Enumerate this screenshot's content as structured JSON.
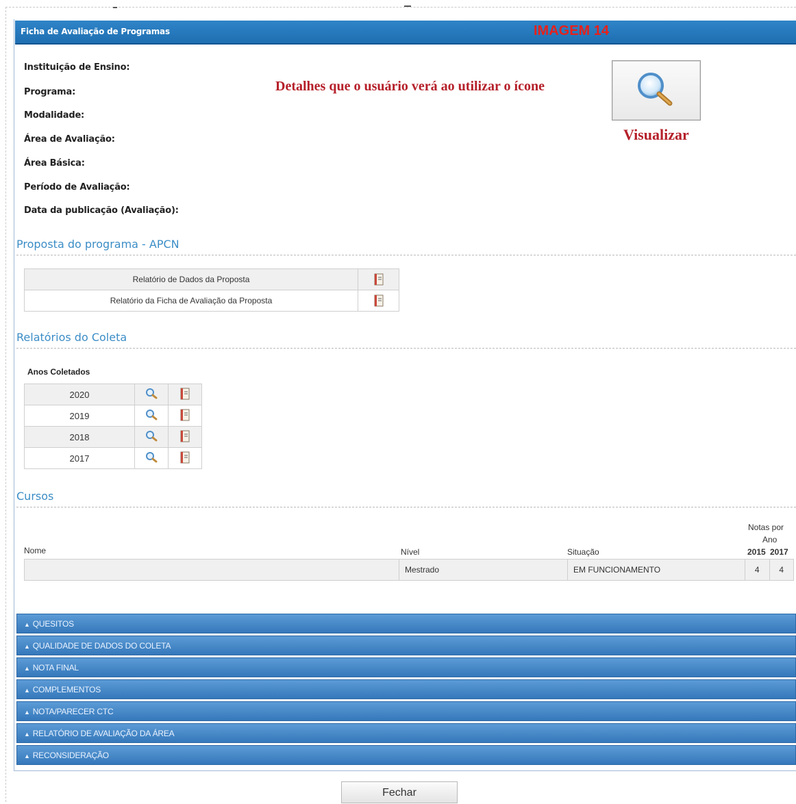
{
  "header": {
    "title": "Ficha de Avaliação de Programas",
    "image_tag": "IMAGEM 14",
    "color": "#1e6fb2"
  },
  "info_labels": [
    "Instituição de Ensino:",
    "Programa:",
    "Modalidade:",
    "Área de Avaliação:",
    "Área Básica:",
    "Período de Avaliação:",
    "Data da publicação (Avaliação):"
  ],
  "annotation": {
    "details_text": "Detalhes que o usuário verá ao utilizar o ícone",
    "visualizar_label": "Visualizar",
    "icon": "magnifier-icon",
    "color": "#b5202a"
  },
  "proposta": {
    "title": "Proposta do programa - APCN",
    "rows": [
      {
        "label": "Relatório de Dados da Proposta",
        "icon": "report-icon"
      },
      {
        "label": "Relatório da Ficha de Avaliação da Proposta",
        "icon": "report-icon"
      }
    ]
  },
  "coleta": {
    "title": "Relatórios do Coleta",
    "years_label": "Anos Coletados",
    "years": [
      "2020",
      "2019",
      "2018",
      "2017"
    ],
    "icons": [
      "search-icon",
      "report-icon"
    ]
  },
  "cursos": {
    "title": "Cursos",
    "headers": {
      "nome": "Nome",
      "nivel": "Nível",
      "situacao": "Situação",
      "notas": [
        "Notas por",
        "Ano"
      ],
      "years": [
        "2015",
        "2017"
      ]
    },
    "rows": [
      {
        "nome": "",
        "nivel": "Mestrado",
        "situacao": "EM FUNCIONAMENTO",
        "notas": [
          "4",
          "4"
        ]
      }
    ]
  },
  "accordions": [
    "QUESITOS",
    "QUALIDADE DE DADOS DO COLETA",
    "NOTA FINAL",
    "COMPLEMENTOS",
    "NOTA/PARECER CTC",
    "RELATÓRIO DE AVALIAÇÃO DA ÁREA",
    "RECONSIDERAÇÃO"
  ],
  "footer": {
    "close_label": "Fechar"
  }
}
